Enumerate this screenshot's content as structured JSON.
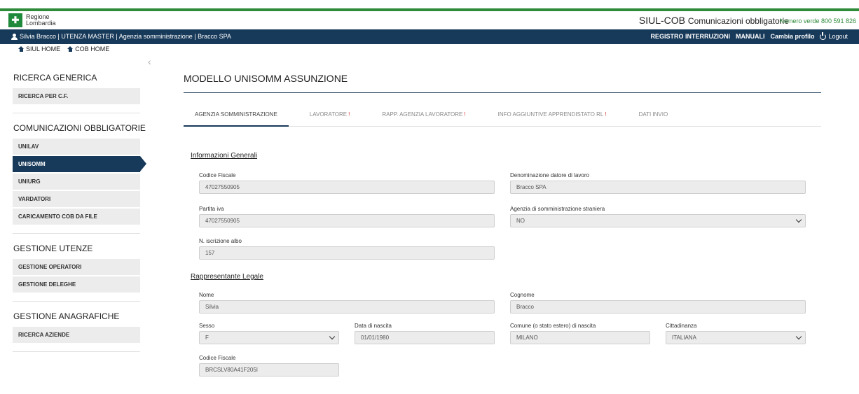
{
  "header": {
    "logo_line1": "Regione",
    "logo_line2": "Lombardia",
    "app_title": "SIUL-COB",
    "app_subtitle": "Comunicazioni obbligatorie",
    "phone": "Numero verde 800 591 826",
    "brand_color": "#2e8b3a"
  },
  "navbar": {
    "user_text": "Silvia Bracco | UTENZA MASTER | Agenzia somministrazione | Bracco SPA",
    "registro": "REGISTRO INTERRUZIONI",
    "manuali": "MANUALI",
    "cambia": "Cambia profilo",
    "logout": "Logout",
    "color": "#183a5a"
  },
  "breadcrumbs": {
    "siul_home": "SIUL HOME",
    "cob_home": "COB HOME"
  },
  "sidebar": {
    "sections": [
      {
        "title": "RICERCA GENERICA",
        "items": [
          "RICERCA PER C.F."
        ]
      },
      {
        "title": "COMUNICAZIONI OBBLIGATORIE",
        "items": [
          "UNILAV",
          "UNISOMM",
          "UNIURG",
          "VARDATORI",
          "CARICAMENTO COB DA FILE"
        ]
      },
      {
        "title": "GESTIONE UTENZE",
        "items": [
          "GESTIONE OPERATORI",
          "GESTIONE DELEGHE"
        ]
      },
      {
        "title": "GESTIONE ANAGRAFICHE",
        "items": [
          "RICERCA AZIENDE"
        ]
      }
    ],
    "active_item": "UNISOMM"
  },
  "main": {
    "title": "MODELLO UNISOMM ASSUNZIONE",
    "tabs": [
      {
        "label": "AGENZIA SOMMINISTRAZIONE",
        "warn": ""
      },
      {
        "label": "LAVORATORE",
        "warn": "!"
      },
      {
        "label": "RAPP. AGENZIA LAVORATORE",
        "warn": "!"
      },
      {
        "label": "INFO AGGIUNTIVE APPRENDISTATO RL",
        "warn": "!"
      },
      {
        "label": "DATI INVIO",
        "warn": ""
      }
    ],
    "active_tab": "AGENZIA SOMMINISTRAZIONE",
    "info_generali": {
      "title": "Informazioni Generali",
      "codice_fiscale_label": "Codice Fiscale",
      "codice_fiscale": "47027550905",
      "denominazione_label": "Denominazione datore di lavoro",
      "denominazione": "Bracco SPA",
      "partita_iva_label": "Partita iva",
      "partita_iva": "47027550905",
      "agenzia_straniera_label": "Agenzia di somministrazione straniera",
      "agenzia_straniera": "NO",
      "iscrizione_label": "N. iscrizione albo",
      "iscrizione": "157"
    },
    "rappresentante": {
      "title": "Rappresentante Legale",
      "nome_label": "Nome",
      "nome": "Silvia",
      "cognome_label": "Cognome",
      "cognome": "Bracco",
      "sesso_label": "Sesso",
      "sesso": "F",
      "nascita_label": "Data di nascita",
      "nascita": "01/01/1980",
      "comune_label": "Comune (o stato estero) di nascita",
      "comune": "MILANO",
      "cittadinanza_label": "Cittadinanza",
      "cittadinanza": "ITALIANA",
      "cf_label": "Codice Fiscale",
      "cf": "BRCSLV80A41F205I"
    }
  }
}
